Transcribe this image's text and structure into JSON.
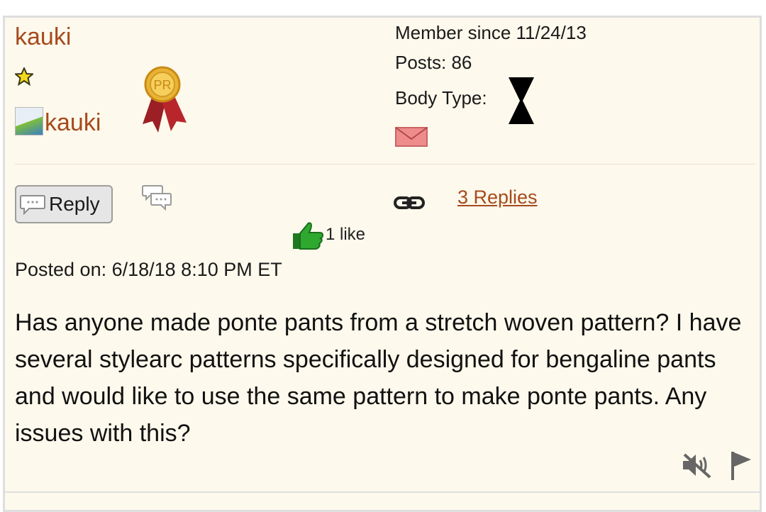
{
  "post": {
    "username": "kauki",
    "avatar_alt": "kauki",
    "member_since": "Member since 11/24/13",
    "posts": "Posts: 86",
    "body_type_label": "Body Type:",
    "reply_label": "Reply",
    "replies_link": "3 Replies",
    "likes": "1 like",
    "posted_on": "Posted on: 6/18/18 8:10 PM ET",
    "message": "Has anyone made ponte pants from a stretch woven pattern? I have several stylearc patterns specifically designed for bengaline pants and would like to use the same pattern to make ponte pants. Any issues with this?",
    "badge_text": "PR"
  },
  "icons": {
    "star": "star-icon",
    "ribbon": "pr-ribbon-icon",
    "bodytype": "hourglass-icon",
    "mail": "envelope-icon",
    "reply": "speech-bubble-icon",
    "chat": "chat-bubbles-icon",
    "link": "chain-link-icon",
    "like": "thumbs-up-icon",
    "mute": "mute-icon",
    "flag": "flag-icon"
  },
  "colors": {
    "background": "#fdf9ec",
    "username": "#a64a1d",
    "link": "#a64a1d",
    "thumb": "#2fa82f",
    "ribbon": "#9b1f24",
    "medal": "#e9b334"
  }
}
